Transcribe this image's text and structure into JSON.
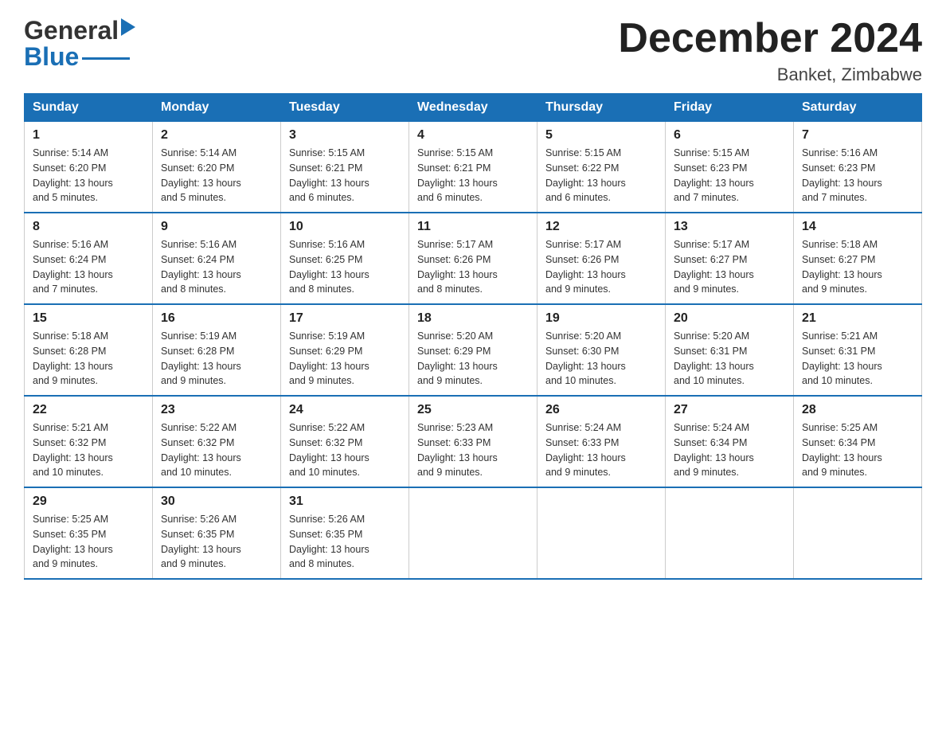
{
  "logo": {
    "text_general": "General",
    "text_blue": "Blue",
    "triangle": "▶"
  },
  "title": {
    "month_year": "December 2024",
    "location": "Banket, Zimbabwe"
  },
  "headers": [
    "Sunday",
    "Monday",
    "Tuesday",
    "Wednesday",
    "Thursday",
    "Friday",
    "Saturday"
  ],
  "weeks": [
    [
      {
        "day": "1",
        "info": "Sunrise: 5:14 AM\nSunset: 6:20 PM\nDaylight: 13 hours\nand 5 minutes."
      },
      {
        "day": "2",
        "info": "Sunrise: 5:14 AM\nSunset: 6:20 PM\nDaylight: 13 hours\nand 5 minutes."
      },
      {
        "day": "3",
        "info": "Sunrise: 5:15 AM\nSunset: 6:21 PM\nDaylight: 13 hours\nand 6 minutes."
      },
      {
        "day": "4",
        "info": "Sunrise: 5:15 AM\nSunset: 6:21 PM\nDaylight: 13 hours\nand 6 minutes."
      },
      {
        "day": "5",
        "info": "Sunrise: 5:15 AM\nSunset: 6:22 PM\nDaylight: 13 hours\nand 6 minutes."
      },
      {
        "day": "6",
        "info": "Sunrise: 5:15 AM\nSunset: 6:23 PM\nDaylight: 13 hours\nand 7 minutes."
      },
      {
        "day": "7",
        "info": "Sunrise: 5:16 AM\nSunset: 6:23 PM\nDaylight: 13 hours\nand 7 minutes."
      }
    ],
    [
      {
        "day": "8",
        "info": "Sunrise: 5:16 AM\nSunset: 6:24 PM\nDaylight: 13 hours\nand 7 minutes."
      },
      {
        "day": "9",
        "info": "Sunrise: 5:16 AM\nSunset: 6:24 PM\nDaylight: 13 hours\nand 8 minutes."
      },
      {
        "day": "10",
        "info": "Sunrise: 5:16 AM\nSunset: 6:25 PM\nDaylight: 13 hours\nand 8 minutes."
      },
      {
        "day": "11",
        "info": "Sunrise: 5:17 AM\nSunset: 6:26 PM\nDaylight: 13 hours\nand 8 minutes."
      },
      {
        "day": "12",
        "info": "Sunrise: 5:17 AM\nSunset: 6:26 PM\nDaylight: 13 hours\nand 9 minutes."
      },
      {
        "day": "13",
        "info": "Sunrise: 5:17 AM\nSunset: 6:27 PM\nDaylight: 13 hours\nand 9 minutes."
      },
      {
        "day": "14",
        "info": "Sunrise: 5:18 AM\nSunset: 6:27 PM\nDaylight: 13 hours\nand 9 minutes."
      }
    ],
    [
      {
        "day": "15",
        "info": "Sunrise: 5:18 AM\nSunset: 6:28 PM\nDaylight: 13 hours\nand 9 minutes."
      },
      {
        "day": "16",
        "info": "Sunrise: 5:19 AM\nSunset: 6:28 PM\nDaylight: 13 hours\nand 9 minutes."
      },
      {
        "day": "17",
        "info": "Sunrise: 5:19 AM\nSunset: 6:29 PM\nDaylight: 13 hours\nand 9 minutes."
      },
      {
        "day": "18",
        "info": "Sunrise: 5:20 AM\nSunset: 6:29 PM\nDaylight: 13 hours\nand 9 minutes."
      },
      {
        "day": "19",
        "info": "Sunrise: 5:20 AM\nSunset: 6:30 PM\nDaylight: 13 hours\nand 10 minutes."
      },
      {
        "day": "20",
        "info": "Sunrise: 5:20 AM\nSunset: 6:31 PM\nDaylight: 13 hours\nand 10 minutes."
      },
      {
        "day": "21",
        "info": "Sunrise: 5:21 AM\nSunset: 6:31 PM\nDaylight: 13 hours\nand 10 minutes."
      }
    ],
    [
      {
        "day": "22",
        "info": "Sunrise: 5:21 AM\nSunset: 6:32 PM\nDaylight: 13 hours\nand 10 minutes."
      },
      {
        "day": "23",
        "info": "Sunrise: 5:22 AM\nSunset: 6:32 PM\nDaylight: 13 hours\nand 10 minutes."
      },
      {
        "day": "24",
        "info": "Sunrise: 5:22 AM\nSunset: 6:32 PM\nDaylight: 13 hours\nand 10 minutes."
      },
      {
        "day": "25",
        "info": "Sunrise: 5:23 AM\nSunset: 6:33 PM\nDaylight: 13 hours\nand 9 minutes."
      },
      {
        "day": "26",
        "info": "Sunrise: 5:24 AM\nSunset: 6:33 PM\nDaylight: 13 hours\nand 9 minutes."
      },
      {
        "day": "27",
        "info": "Sunrise: 5:24 AM\nSunset: 6:34 PM\nDaylight: 13 hours\nand 9 minutes."
      },
      {
        "day": "28",
        "info": "Sunrise: 5:25 AM\nSunset: 6:34 PM\nDaylight: 13 hours\nand 9 minutes."
      }
    ],
    [
      {
        "day": "29",
        "info": "Sunrise: 5:25 AM\nSunset: 6:35 PM\nDaylight: 13 hours\nand 9 minutes."
      },
      {
        "day": "30",
        "info": "Sunrise: 5:26 AM\nSunset: 6:35 PM\nDaylight: 13 hours\nand 9 minutes."
      },
      {
        "day": "31",
        "info": "Sunrise: 5:26 AM\nSunset: 6:35 PM\nDaylight: 13 hours\nand 8 minutes."
      },
      null,
      null,
      null,
      null
    ]
  ]
}
